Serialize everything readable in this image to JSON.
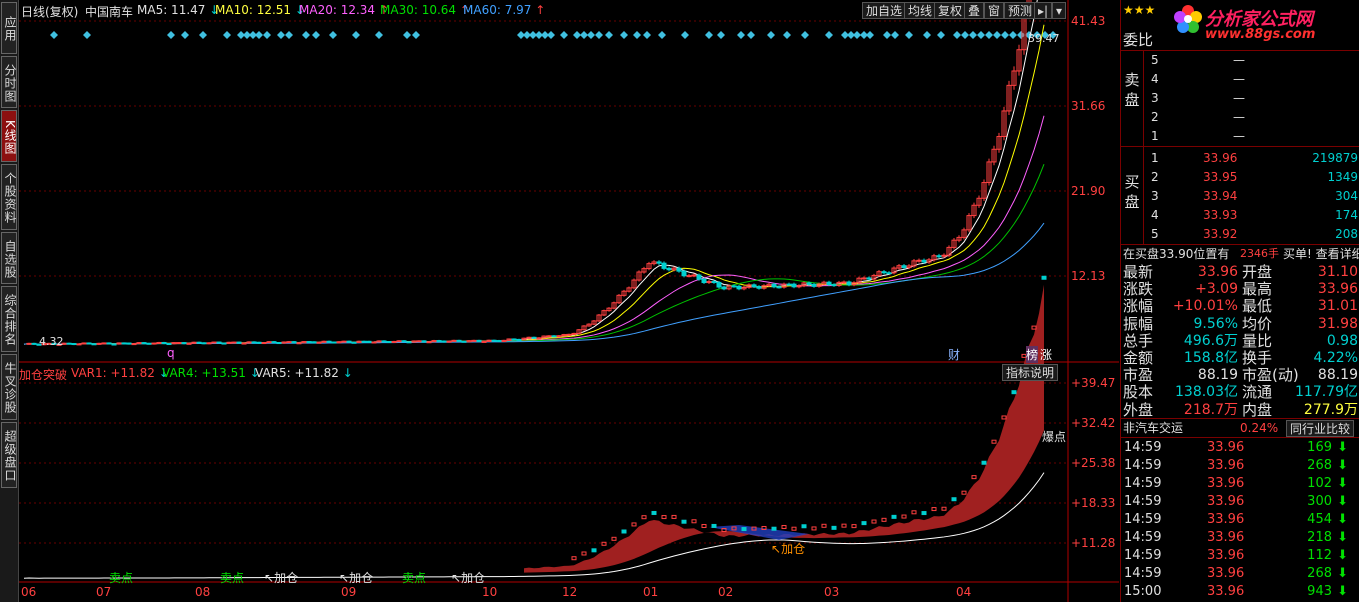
{
  "sidebar": {
    "tabs": [
      {
        "label": "应用",
        "active": false
      },
      {
        "label": "分时图",
        "active": false
      },
      {
        "label": "K线图",
        "active": true
      },
      {
        "label": "个股资料",
        "active": false
      },
      {
        "label": "自选股",
        "active": false
      },
      {
        "label": "综合排名",
        "active": false
      },
      {
        "label": "牛叉诊股",
        "active": false
      },
      {
        "label": "超级盘口",
        "active": false
      }
    ]
  },
  "chart_header": {
    "title": "日线(复权)",
    "stock_name": "中国南车",
    "ma5": "MA5: 11.47",
    "ma10": "MA10: 12.51",
    "ma20": "MA20: 12.34",
    "ma30": "MA30: 10.64",
    "ma60": "MA60: 7.97"
  },
  "toolbar": {
    "add_watch": "加自选",
    "average_line": "均线",
    "restore_right": "复权",
    "overlay": "叠",
    "window": "窗",
    "forecast": "预测"
  },
  "price_axis": [
    "41.43",
    "31.66",
    "21.90",
    "12.13"
  ],
  "chart_markers": {
    "low_price": "4.32",
    "high_price": "39.47",
    "marker_q": "q",
    "marker_cai": "财",
    "marker_bang": "榜",
    "marker_zhang": "涨"
  },
  "indicator": {
    "name": "加仓突破",
    "var1": "VAR1: +11.82",
    "var4": "VAR4: +13.51",
    "var5": "VAR5: +11.82",
    "help_button": "指标说明",
    "axis": [
      "+39.47",
      "+32.42",
      "+25.38",
      "+18.33",
      "+11.28"
    ],
    "signals": [
      "卖点",
      "卖点",
      "加仓",
      "加仓",
      "卖点",
      "加仓",
      "加仓",
      "爆点"
    ]
  },
  "time_axis": [
    "06",
    "07",
    "08",
    "09",
    "10",
    "12",
    "01",
    "02",
    "03",
    "04"
  ],
  "quote": {
    "header_label": "委比",
    "logo_text": "分析家公式网",
    "logo_url": "www.88gs.com",
    "sell_label": "卖盘",
    "buy_label": "买盘",
    "sell_rows": [
      {
        "n": "5",
        "price": "—",
        "vol": ""
      },
      {
        "n": "4",
        "price": "—",
        "vol": ""
      },
      {
        "n": "3",
        "price": "—",
        "vol": ""
      },
      {
        "n": "2",
        "price": "—",
        "vol": ""
      },
      {
        "n": "1",
        "price": "—",
        "vol": ""
      }
    ],
    "buy_rows": [
      {
        "n": "1",
        "price": "33.96",
        "vol": "219879"
      },
      {
        "n": "2",
        "price": "33.95",
        "vol": "1349"
      },
      {
        "n": "3",
        "price": "33.94",
        "vol": "304"
      },
      {
        "n": "4",
        "price": "33.93",
        "vol": "174"
      },
      {
        "n": "5",
        "price": "33.92",
        "vol": "208"
      }
    ],
    "notice_prefix": "在买盘33.90位置有",
    "notice_amount": "2346手",
    "notice_suffix": "买单! 查看详细",
    "stats": [
      {
        "l1": "最新",
        "v1": "33.96",
        "c1": "red",
        "l2": "开盘",
        "v2": "31.10",
        "c2": "red"
      },
      {
        "l1": "涨跌",
        "v1": "+3.09",
        "c1": "red",
        "l2": "最高",
        "v2": "33.96",
        "c2": "red"
      },
      {
        "l1": "涨幅",
        "v1": "+10.01%",
        "c1": "red",
        "l2": "最低",
        "v2": "31.01",
        "c2": "red"
      },
      {
        "l1": "振幅",
        "v1": "9.56%",
        "c1": "cyan",
        "l2": "均价",
        "v2": "31.98",
        "c2": "red"
      },
      {
        "l1": "总手",
        "v1": "496.6万",
        "c1": "cyan",
        "l2": "量比",
        "v2": "0.98",
        "c2": "cyan"
      },
      {
        "l1": "金额",
        "v1": "158.8亿",
        "c1": "cyan",
        "l2": "换手",
        "v2": "4.22%",
        "c2": "cyan"
      },
      {
        "l1": "市盈",
        "v1": "88.19",
        "c1": "white",
        "l2": "市盈(动)",
        "v2": "88.19",
        "c2": "white"
      },
      {
        "l1": "股本",
        "v1": "138.03亿",
        "c1": "cyan",
        "l2": "流通",
        "v2": "117.79亿",
        "c2": "cyan"
      },
      {
        "l1": "外盘",
        "v1": "218.7万",
        "c1": "red",
        "l2": "内盘",
        "v2": "277.9万",
        "c2": "yellow"
      }
    ],
    "sector_label": "非汽车交运",
    "sector_change": "0.24%",
    "industry_compare": "同行业比较",
    "ticks": [
      {
        "time": "14:59",
        "price": "33.96",
        "vol": "169"
      },
      {
        "time": "14:59",
        "price": "33.96",
        "vol": "268"
      },
      {
        "time": "14:59",
        "price": "33.96",
        "vol": "102"
      },
      {
        "time": "14:59",
        "price": "33.96",
        "vol": "300"
      },
      {
        "time": "14:59",
        "price": "33.96",
        "vol": "454"
      },
      {
        "time": "14:59",
        "price": "33.96",
        "vol": "218"
      },
      {
        "time": "14:59",
        "price": "33.96",
        "vol": "112"
      },
      {
        "time": "14:59",
        "price": "33.96",
        "vol": "268"
      },
      {
        "time": "15:00",
        "price": "33.96",
        "vol": "943"
      }
    ]
  },
  "colors": {
    "up": "#ff4040",
    "down": "#00d0d0",
    "ma5": "#ffffff",
    "ma10": "#ffff00",
    "ma20": "#ff60ff",
    "ma30": "#00c000",
    "ma60": "#40a0ff",
    "grid": "#800000"
  }
}
